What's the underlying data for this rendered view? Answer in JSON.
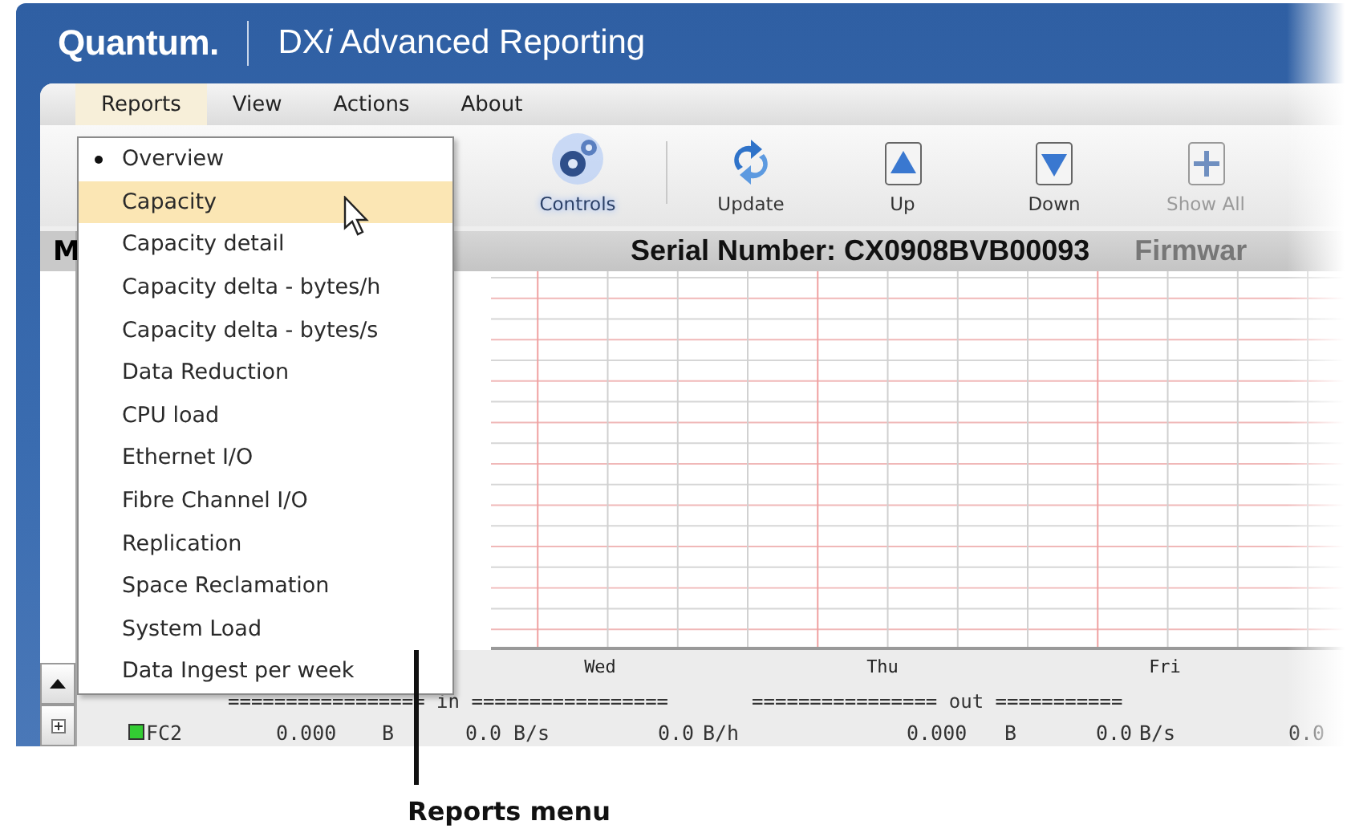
{
  "app": {
    "logo": "Quantum.",
    "title": [
      {
        "text": "DX",
        "italic": false
      },
      {
        "text": "i",
        "italic": true
      },
      {
        "text": " Advanced Reporting",
        "italic": false
      }
    ]
  },
  "menu_bar": [
    {
      "label": "Reports",
      "selected": true
    },
    {
      "label": "View",
      "selected": false
    },
    {
      "label": "Actions",
      "selected": false
    },
    {
      "label": "About",
      "selected": false
    }
  ],
  "toolbar": [
    {
      "kind": "controls",
      "label": "Controls",
      "active": true,
      "disabled": false
    },
    {
      "kind": "update",
      "label": "Update",
      "active": false,
      "disabled": false
    },
    {
      "kind": "up",
      "label": "Up",
      "active": false,
      "disabled": false
    },
    {
      "kind": "down",
      "label": "Down",
      "active": false,
      "disabled": false
    },
    {
      "kind": "showall",
      "label": "Show All",
      "active": false,
      "disabled": true
    }
  ],
  "header": {
    "column_1": "M",
    "serial": "Serial Number: CX0908BVB00093",
    "firmware": "Firmwar"
  },
  "chart": {
    "days": [
      "Wed",
      "Thu",
      "Fri"
    ],
    "legend_in": "================= in =================",
    "legend_out": "================ out ==========="
  },
  "rows": [
    {
      "color": "#33cc33",
      "name": "FC2",
      "cells": [
        "0.000",
        "B",
        "0.0",
        "B/s",
        "0.0",
        "B/h",
        "0.000",
        "B",
        "0.0",
        "B/s",
        "0.0"
      ]
    }
  ],
  "reports_menu": [
    {
      "label": "Overview",
      "checked": true,
      "highlighted": false
    },
    {
      "label": "Capacity",
      "checked": false,
      "highlighted": true
    },
    {
      "label": "Capacity detail",
      "checked": false,
      "highlighted": false
    },
    {
      "label": "Capacity delta - bytes/h",
      "checked": false,
      "highlighted": false
    },
    {
      "label": "Capacity delta - bytes/s",
      "checked": false,
      "highlighted": false
    },
    {
      "label": "Data Reduction",
      "checked": false,
      "highlighted": false
    },
    {
      "label": "CPU load",
      "checked": false,
      "highlighted": false
    },
    {
      "label": "Ethernet I/O",
      "checked": false,
      "highlighted": false
    },
    {
      "label": "Fibre Channel I/O",
      "checked": false,
      "highlighted": false
    },
    {
      "label": "Replication",
      "checked": false,
      "highlighted": false
    },
    {
      "label": "Space Reclamation",
      "checked": false,
      "highlighted": false
    },
    {
      "label": "System Load",
      "checked": false,
      "highlighted": false
    },
    {
      "label": "Data Ingest per week",
      "checked": false,
      "highlighted": false
    }
  ],
  "callout": "Reports menu"
}
